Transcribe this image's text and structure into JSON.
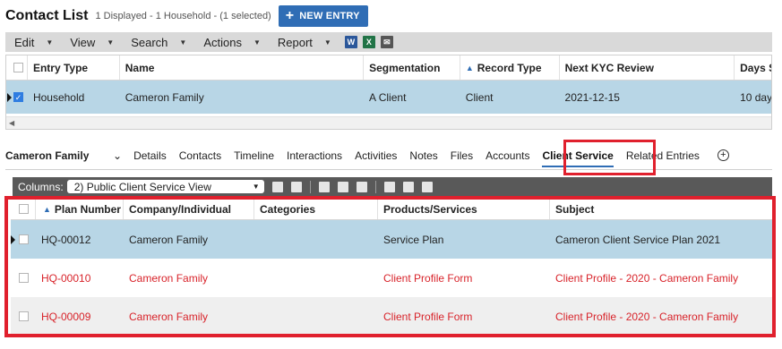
{
  "header": {
    "title": "Contact List",
    "subtitle": "1 Displayed - 1 Household - (1 selected)",
    "new_entry_label": "NEW ENTRY"
  },
  "menu": {
    "items": [
      "Edit",
      "View",
      "Search",
      "Actions",
      "Report"
    ]
  },
  "top_grid": {
    "columns": [
      "Entry Type",
      "Name",
      "Segmentation",
      "Record Type",
      "Next KYC Review",
      "Days S"
    ],
    "row": {
      "entry_type": "Household",
      "name": "Cameron Family",
      "segmentation": "A Client",
      "record_type": "Client",
      "next_kyc_review": "2021-12-15",
      "days": "10 day"
    }
  },
  "detail": {
    "entity_name": "Cameron Family",
    "tabs": [
      "Details",
      "Contacts",
      "Timeline",
      "Interactions",
      "Activities",
      "Notes",
      "Files",
      "Accounts",
      "Client Service",
      "Related Entries"
    ],
    "active_tab": "Client Service"
  },
  "sub_toolbar": {
    "columns_label": "Columns:",
    "columns_value": "2) Public Client Service View"
  },
  "service_grid": {
    "columns": [
      "Plan Number",
      "Company/Individual",
      "Categories",
      "Products/Services",
      "Subject"
    ],
    "rows": [
      {
        "plan": "HQ-00012",
        "company": "Cameron Family",
        "categories": "",
        "product": "Service Plan",
        "subject": "Cameron Client Service Plan 2021",
        "state": "selected"
      },
      {
        "plan": "HQ-00010",
        "company": "Cameron Family",
        "categories": "",
        "product": "Client Profile Form",
        "subject": "Client Profile - 2020 - Cameron Family",
        "state": "overdue"
      },
      {
        "plan": "HQ-00009",
        "company": "Cameron Family",
        "categories": "",
        "product": "Client Profile Form",
        "subject": "Client Profile - 2020 - Cameron Family",
        "state": "overdue"
      }
    ]
  },
  "colors": {
    "accent": "#2f6db5",
    "highlight": "#e0202d",
    "selected_row": "#b8d6e6",
    "overdue_text": "#d8232a",
    "toolbar_dark": "#595959"
  }
}
